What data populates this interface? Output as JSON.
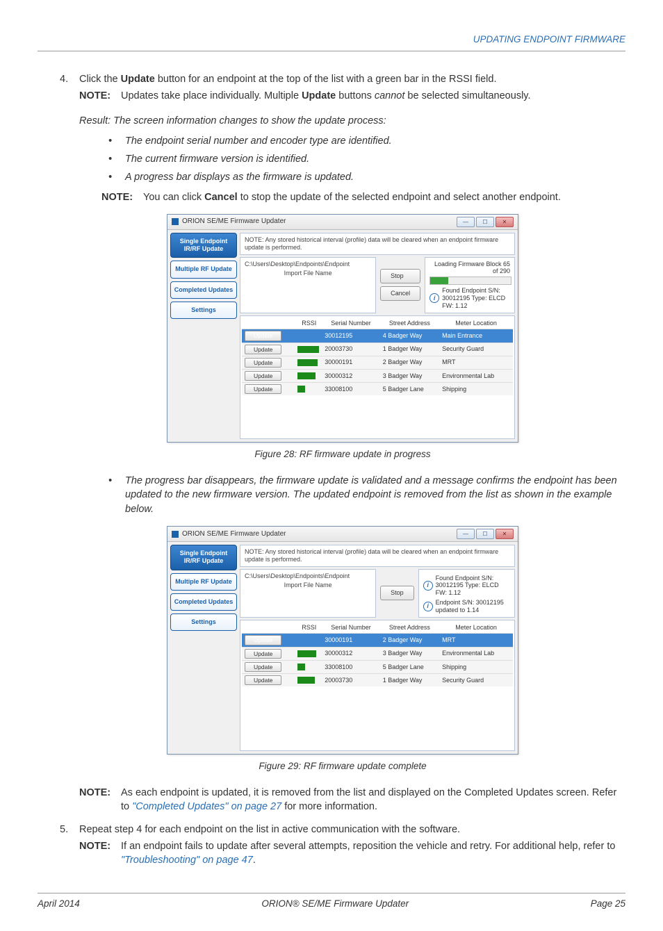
{
  "header": {
    "sectionLink": "UPDATING ENDPOINT FIRMWARE"
  },
  "step4": {
    "num": "4.",
    "text_pre": "Click the ",
    "text_bold1": "Update",
    "text_mid": " button for an endpoint at the top of the list with a green bar in the RSSI field.",
    "note_pre": "Updates take place individually. Multiple ",
    "note_bold": "Update",
    "note_mid": " buttons ",
    "note_ital": "cannot",
    "note_end": " be selected simultaneously.",
    "result": "Result:   The screen information changes to show the update process:",
    "bullets": [
      "The endpoint serial number and encoder type are identified.",
      "The current firmware version is identified.",
      "A progress bar displays as the firmware is updated."
    ],
    "note2_pre": "You can click ",
    "note2_bold": "Cancel",
    "note2_end": " to stop the update of the selected endpoint and select another endpoint."
  },
  "labels": {
    "note": "NOTE:"
  },
  "fig28": {
    "caption": "Figure 28:  RF firmware update in progress",
    "title": "ORION SE/ME Firmware Updater",
    "sidebar": [
      "Single Endpoint IR/RF Update",
      "Multiple RF Update",
      "Completed Updates",
      "Settings"
    ],
    "noteText": "NOTE: Any stored historical interval (profile) data will be cleared when an endpoint firmware update is performed.",
    "path": "C:\\Users\\Desktop\\Endpoints\\Endpoint",
    "importLabel": "Import File Name",
    "stopBtn": "Stop",
    "cancelBtn": "Cancel",
    "loadingText": "Loading Firmware Block 65 of 290",
    "foundText": "Found Endpoint S/N: 30012195 Type: ELCD FW: 1.12",
    "progressPct": 22,
    "cols": [
      "",
      "RSSI",
      "Serial Number",
      "Street Address",
      "Meter Location"
    ],
    "updateBtn": "Update",
    "rows": [
      {
        "sel": true,
        "rssi": 0,
        "sn": "30012195",
        "addr": "4 Badger Way",
        "loc": "Main Entrance"
      },
      {
        "sel": false,
        "rssi": 82,
        "sn": "20003730",
        "addr": "1 Badger Way",
        "loc": "Security Guard"
      },
      {
        "sel": false,
        "rssi": 78,
        "sn": "30000191",
        "addr": "2 Badger Way",
        "loc": "MRT"
      },
      {
        "sel": false,
        "rssi": 70,
        "sn": "30000312",
        "addr": "3 Badger Way",
        "loc": "Environmental Lab"
      },
      {
        "sel": false,
        "rssi": 30,
        "sn": "33008100",
        "addr": "5 Badger Lane",
        "loc": "Shipping"
      }
    ]
  },
  "afterFig28": {
    "bullet": "The progress bar disappears, the firmware update is validated and a message confirms the endpoint has been updated to the new firmware version. The updated endpoint is removed from the list as shown in the example below."
  },
  "fig29": {
    "caption": "Figure 29:  RF firmware update complete",
    "title": "ORION SE/ME Firmware Updater",
    "sidebar": [
      "Single Endpoint IR/RF Update",
      "Multiple RF Update",
      "Completed Updates",
      "Settings"
    ],
    "noteText": "NOTE: Any stored historical interval (profile) data will be cleared when an endpoint firmware update is performed.",
    "path": "C:\\Users\\Desktop\\Endpoints\\Endpoint",
    "importLabel": "Import File Name",
    "stopBtn": "Stop",
    "foundText": "Found Endpoint S/N: 30012195 Type: ELCD FW: 1.12",
    "updatedText": "Endpoint S/N: 30012195 updated to 1.14",
    "cols": [
      "",
      "RSSI",
      "Serial Number",
      "Street Address",
      "Meter Location"
    ],
    "updateBtn": "Update",
    "rows": [
      {
        "sel": true,
        "rssi": 0,
        "sn": "30000191",
        "addr": "2 Badger Way",
        "loc": "MRT"
      },
      {
        "sel": false,
        "rssi": 72,
        "sn": "30000312",
        "addr": "3 Badger Way",
        "loc": "Environmental Lab"
      },
      {
        "sel": false,
        "rssi": 30,
        "sn": "33008100",
        "addr": "5 Badger Lane",
        "loc": "Shipping"
      },
      {
        "sel": false,
        "rssi": 68,
        "sn": "20003730",
        "addr": "1 Badger Way",
        "loc": "Security Guard"
      }
    ]
  },
  "noteCompleted": {
    "text_pre": "As each endpoint is updated, it is removed from the list and displayed on the Completed Updates screen. Refer to ",
    "link": "\"Completed Updates\" on page 27",
    "text_end": " for more information."
  },
  "step5": {
    "num": "5.",
    "text": "Repeat step 4 for each endpoint on the list in active communication with the software.",
    "note_pre": "If an endpoint fails to update after several attempts, reposition the vehicle and retry. For additional help, refer to ",
    "note_link": "\"Troubleshooting\" on page 47",
    "note_end": "."
  },
  "footer": {
    "left": "April 2014",
    "center": "ORION® SE/ME Firmware Updater",
    "right": "Page 25"
  }
}
